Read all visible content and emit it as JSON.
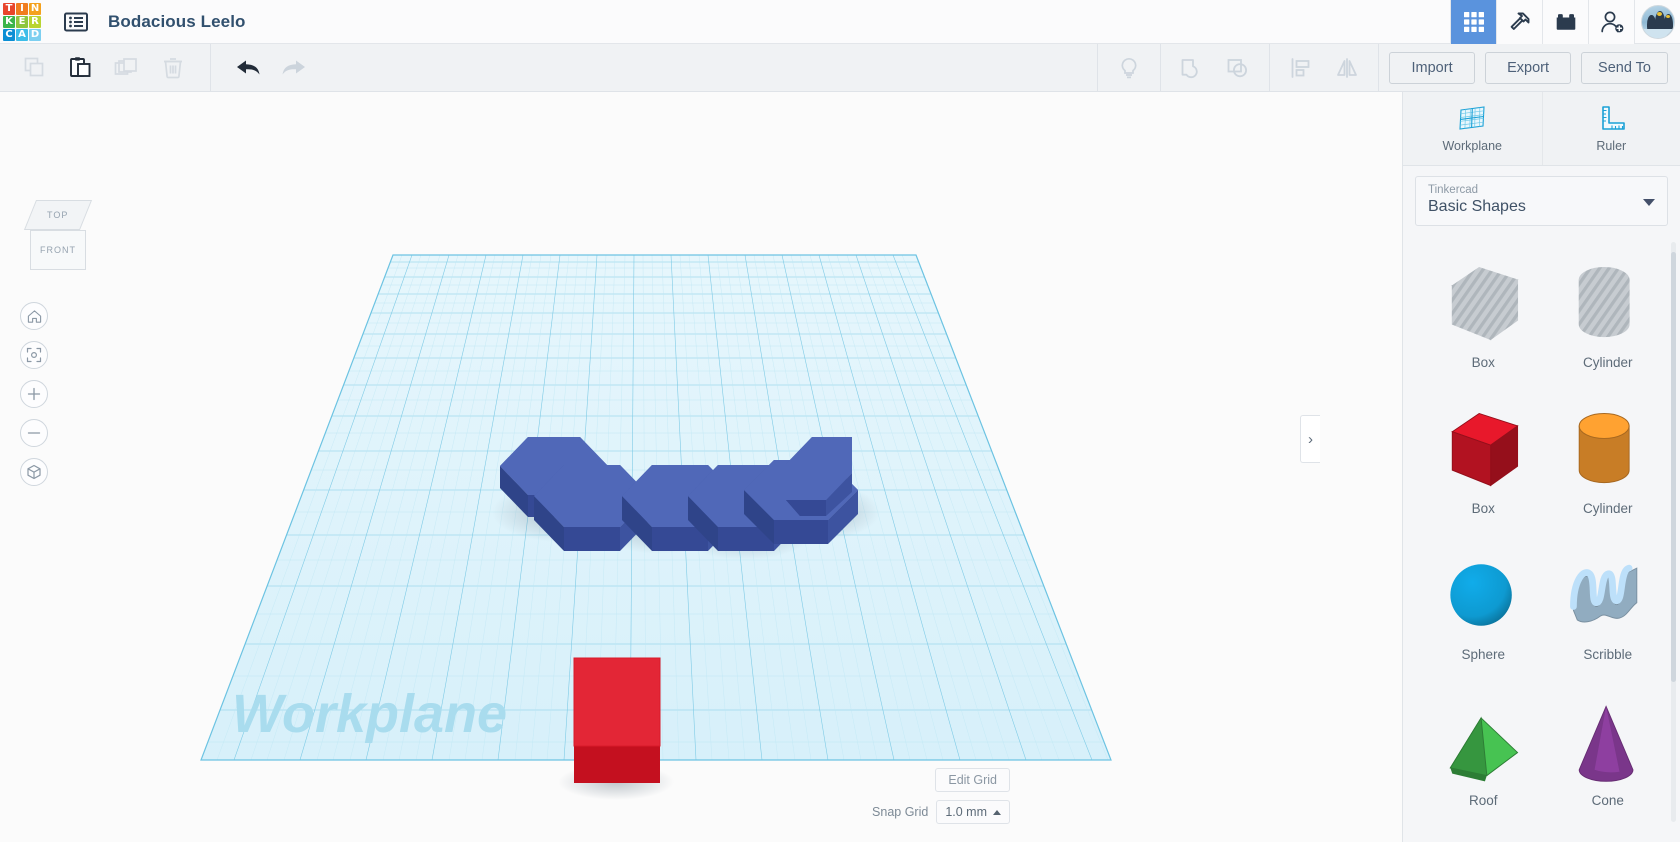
{
  "app": {
    "name": "Tinkercad",
    "logo_letters": [
      "T",
      "I",
      "N",
      "K",
      "E",
      "R",
      "C",
      "A",
      "D"
    ],
    "logo_colors": [
      "#e8452c",
      "#f07c1f",
      "#f4a11d",
      "#3bb44a",
      "#8dc63f",
      "#b9d432",
      "#0b8fd4",
      "#3dbde8",
      "#7dcff0"
    ]
  },
  "topbar": {
    "document_title": "Bodacious Leelo",
    "menu_icon": "list-menu-icon",
    "icons": [
      {
        "name": "grid-gallery-icon",
        "active": true
      },
      {
        "name": "hammer-tools-icon",
        "active": false
      },
      {
        "name": "lego-brick-icon",
        "active": false
      },
      {
        "name": "add-person-icon",
        "active": false
      }
    ],
    "avatar_alt": "penguin-avatar"
  },
  "toolbar": {
    "left_tools": [
      {
        "name": "copy-button",
        "label": "Copy",
        "enabled": false
      },
      {
        "name": "paste-button",
        "label": "Paste",
        "enabled": true
      },
      {
        "name": "duplicate-button",
        "label": "Duplicate",
        "enabled": false
      },
      {
        "name": "delete-button",
        "label": "Delete",
        "enabled": false
      }
    ],
    "history_tools": [
      {
        "name": "undo-button",
        "label": "Undo",
        "enabled": true
      },
      {
        "name": "redo-button",
        "label": "Redo",
        "enabled": false
      }
    ],
    "right_tools": [
      {
        "name": "notes-button",
        "label": "Notes",
        "enabled": false
      },
      {
        "name": "group-button",
        "label": "Group",
        "enabled": false
      },
      {
        "name": "ungroup-button",
        "label": "Ungroup",
        "enabled": false
      },
      {
        "name": "align-button",
        "label": "Align",
        "enabled": false
      },
      {
        "name": "mirror-button",
        "label": "Mirror",
        "enabled": false
      }
    ],
    "import_label": "Import",
    "export_label": "Export",
    "sendto_label": "Send To"
  },
  "viewcube": {
    "top_face": "TOP",
    "front_face": "FRONT"
  },
  "view_controls": [
    {
      "name": "home-view-button",
      "label": "Home view",
      "icon": "home-icon"
    },
    {
      "name": "fit-view-button",
      "label": "Fit all in view",
      "icon": "fit-frame-icon"
    },
    {
      "name": "zoom-in-button",
      "label": "Zoom in",
      "icon": "plus-icon"
    },
    {
      "name": "zoom-out-button",
      "label": "Zoom out",
      "icon": "minus-icon"
    },
    {
      "name": "ortho-toggle-button",
      "label": "Switch to orthographic view",
      "icon": "cube-icon"
    }
  ],
  "canvas": {
    "workplane_label": "Workplane",
    "edit_grid_label": "Edit Grid",
    "snap_grid_label": "Snap Grid",
    "snap_grid_value": "1.0 mm",
    "shapes_on_plane": [
      {
        "name": "hexagonal-prism",
        "color": "#3f5aa6",
        "count": 6
      },
      {
        "name": "red-box",
        "color": "#d2202f",
        "count": 1
      }
    ]
  },
  "right_panel": {
    "tools": [
      {
        "name": "workplane-tool",
        "label": "Workplane",
        "icon": "workplane-grid-icon"
      },
      {
        "name": "ruler-tool",
        "label": "Ruler",
        "icon": "ruler-icon"
      }
    ],
    "library_source": "Tinkercad",
    "library_name": "Basic Shapes",
    "shapes": [
      {
        "label": "Box",
        "kind": "box",
        "fill": "#c7ccd1",
        "hatched": true
      },
      {
        "label": "Cylinder",
        "kind": "cylinder",
        "fill": "#c7ccd1",
        "hatched": true
      },
      {
        "label": "Box",
        "kind": "box",
        "fill": "#cf1526",
        "hatched": false
      },
      {
        "label": "Cylinder",
        "kind": "cylinder",
        "fill": "#e8912c",
        "hatched": false
      },
      {
        "label": "Sphere",
        "kind": "sphere",
        "fill": "#0e9ad1",
        "hatched": false
      },
      {
        "label": "Scribble",
        "kind": "scribble",
        "fill": "#a9c8df",
        "hatched": false
      },
      {
        "label": "Roof",
        "kind": "roof",
        "fill": "#3fae49",
        "hatched": false
      },
      {
        "label": "Cone",
        "kind": "cone",
        "fill": "#8e3fa0",
        "hatched": false
      }
    ]
  },
  "side_chevron": "›",
  "colors": {
    "accent_blue": "#5a93dd",
    "panel_bg": "#f5f6f8",
    "workplane_blue": "#8fd4ea",
    "title_blue": "#31506e"
  }
}
